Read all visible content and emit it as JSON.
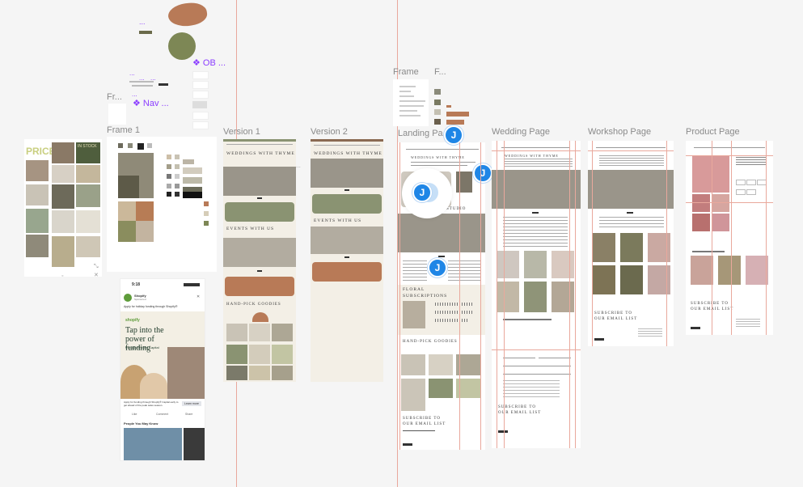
{
  "canvas": {
    "frame_labels": {
      "fr": "Fr...",
      "frame1": "Frame 1",
      "version1": "Version 1",
      "version2": "Version 2",
      "frame": "Frame",
      "f": "F...",
      "landing": "Landing Pa",
      "wedding": "Wedding Page",
      "workshop": "Workshop Page",
      "product": "Product Page"
    },
    "components": {
      "ob": "❖ OB ...",
      "nav": "❖ Nav ..."
    },
    "dots": "...",
    "moodboard_title": "PRICES",
    "moodboard_stock": "IN STOCK"
  },
  "collaborators": [
    "J",
    "J",
    "J",
    "J"
  ],
  "ad": {
    "time": "9:18",
    "advertiser": "Shopify",
    "sub": "Sponsored",
    "body": "Apply for holiday funding through Shopify®",
    "brand": "shopify",
    "headline": "Tap into the power of funding",
    "subline": "through Shopify Capital",
    "cta_text": "Apply for funding through Shopify® Capital early to get ahead of the peak sales season.",
    "cta_button": "Learn more",
    "like": "Like",
    "comment": "Comment",
    "share": "Share",
    "people": "People You May Know"
  },
  "site": {
    "weddings": "WEDDINGS WITH THYME",
    "events": "EVENTS WITH US",
    "goodies": "HAND-PICK GOODIES",
    "floral": "FLORAL SUBSCRIPTIONS",
    "subscribe": "SUBSCRIBE TO OUR EMAIL LIST",
    "studio": "STUDIO"
  },
  "colors": {
    "sage": "#8a9372",
    "terracotta": "#b87a57",
    "cream": "#f3efe6",
    "guide": "#e9a89c",
    "avatar": "#1f86e6",
    "component": "#8b3dff"
  }
}
